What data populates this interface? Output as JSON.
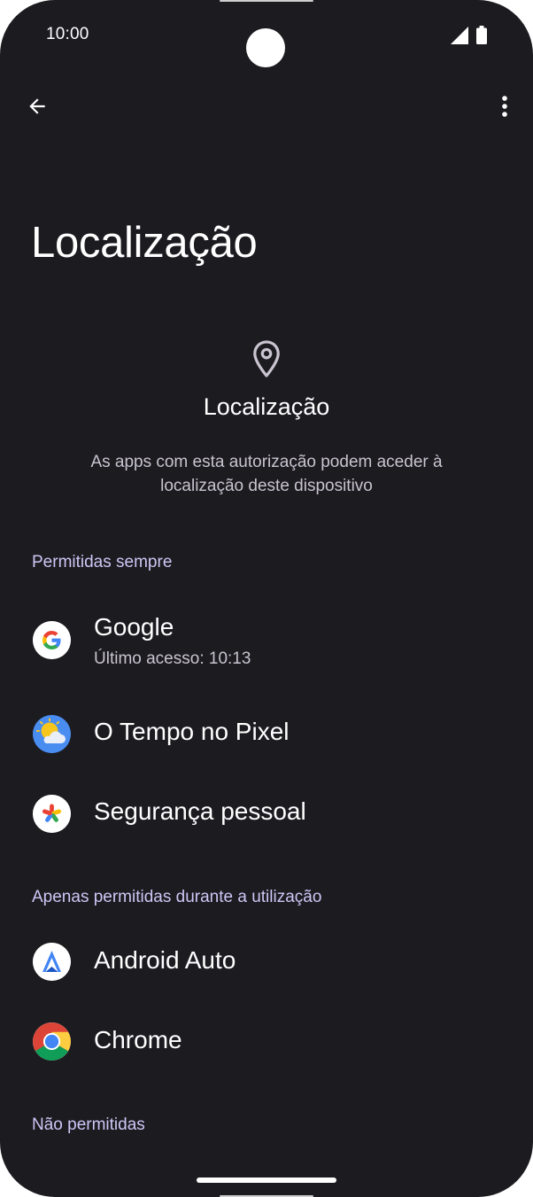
{
  "status_bar": {
    "time": "10:00",
    "signal_icon": "cell-signal-icon",
    "battery_icon": "battery-icon"
  },
  "toolbar": {
    "back_icon": "arrow-back-icon",
    "more_icon": "more-vert-icon"
  },
  "page": {
    "title": "Localização"
  },
  "header": {
    "icon": "location-pin-icon",
    "title": "Localização",
    "description": "As apps com esta autorização podem aceder à localização deste dispositivo"
  },
  "sections": {
    "always": {
      "title": "Permitidas sempre",
      "apps": [
        {
          "name": "Google",
          "subtitle": "Último acesso: 10:13",
          "icon": "google-g-icon"
        },
        {
          "name": "O Tempo no Pixel",
          "icon": "weather-sun-cloud-icon"
        },
        {
          "name": "Segurança pessoal",
          "icon": "personal-safety-star-icon"
        }
      ]
    },
    "while_using": {
      "title": "Apenas permitidas durante a utilização",
      "apps": [
        {
          "name": "Android Auto",
          "icon": "android-auto-icon"
        },
        {
          "name": "Chrome",
          "icon": "chrome-icon"
        }
      ]
    },
    "denied": {
      "title": "Não permitidas"
    }
  },
  "colors": {
    "background": "#1c1b20",
    "section_title": "#cfc6f5",
    "primary_text": "#ffffff",
    "secondary_text": "#c9c4d0"
  }
}
